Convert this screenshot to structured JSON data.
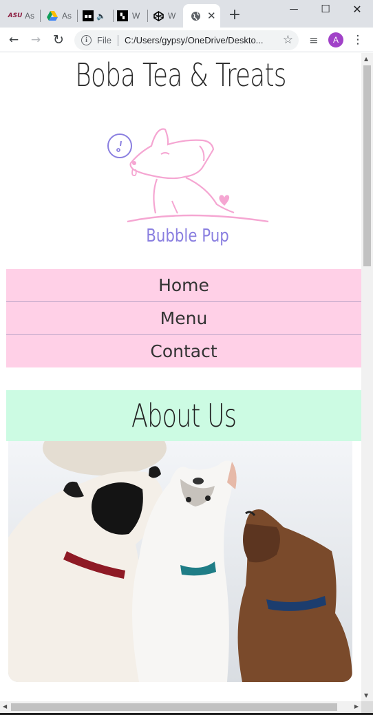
{
  "browser": {
    "tabs": [
      {
        "title": "As",
        "icon": "asu-logo-icon",
        "active": false
      },
      {
        "title": "As",
        "icon": "google-drive-icon",
        "active": false
      },
      {
        "title": "W",
        "icon": "media-icon",
        "active": false
      },
      {
        "title": "W",
        "icon": "doc-icon",
        "active": false
      },
      {
        "title": "W",
        "icon": "codepen-icon",
        "active": false
      },
      {
        "title": "",
        "icon": "globe-icon",
        "active": true
      }
    ],
    "new_tab": "+",
    "tab_close": "✕",
    "window_controls": {
      "minimize": "—",
      "maximize": "☐",
      "close": "✕"
    },
    "toolbar": {
      "back": "←",
      "forward": "→",
      "reload": "↻",
      "info": "i",
      "scheme_label": "File",
      "url": "C:/Users/gypsy/OneDrive/Deskto...",
      "star": "☆",
      "reading_list": "≡",
      "avatar_letter": "A",
      "menu": "⋮"
    },
    "colors": {
      "tabstrip": "#dee1e6",
      "avatar": "#a142c8"
    }
  },
  "page": {
    "site_title": "Boba Tea & Treats",
    "logo": {
      "text": "Bubble Pup",
      "icon": "corgi-logo-icon"
    },
    "nav": [
      {
        "label": "Home"
      },
      {
        "label": "Menu"
      },
      {
        "label": "Contact"
      }
    ],
    "about": {
      "title": "About Us"
    },
    "photo": {
      "description_icon": "dogs-photo-icon"
    },
    "colors": {
      "nav_bg": "#ffd0e7",
      "about_bg": "#ccfbe3",
      "logo_purple": "#8a7fe0",
      "logo_pink": "#f5a6d2"
    }
  }
}
